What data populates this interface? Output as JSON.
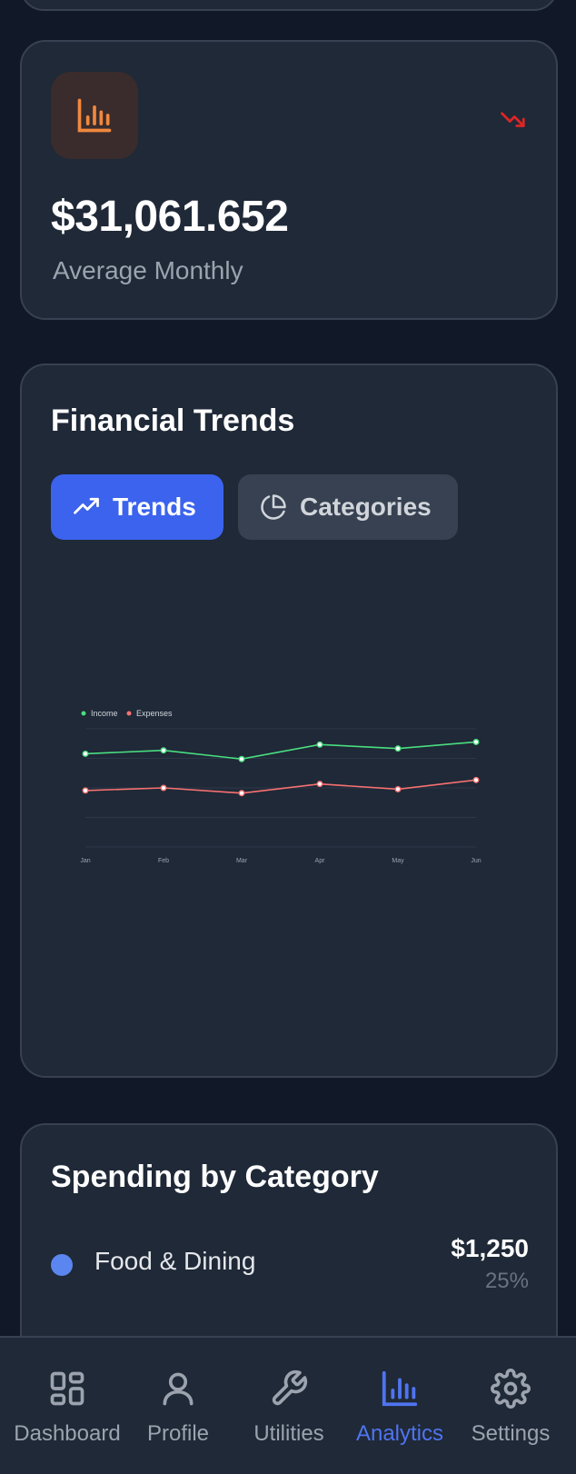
{
  "stat_card": {
    "icon": "bar-chart-icon",
    "trend_icon": "trending-down-icon",
    "value": "$31,061.652",
    "label": "Average Monthly",
    "accent": "#f0883e",
    "trend_color": "#dc2626"
  },
  "trends_card": {
    "title": "Financial Trends",
    "tabs": [
      {
        "label": "Trends",
        "icon": "trending-up-icon",
        "active": true
      },
      {
        "label": "Categories",
        "icon": "pie-chart-icon",
        "active": false
      }
    ]
  },
  "chart_data": {
    "type": "line",
    "x": [
      "Jan",
      "Feb",
      "Mar",
      "Apr",
      "May",
      "Jun"
    ],
    "series": [
      {
        "name": "Income",
        "color": "#4ade80",
        "values": [
          35500,
          36800,
          33500,
          39000,
          37500,
          40000
        ]
      },
      {
        "name": "Expenses",
        "color": "#f87171",
        "values": [
          21500,
          22500,
          20500,
          24000,
          22000,
          25500
        ]
      }
    ],
    "ylim": [
      0,
      45000
    ],
    "grid": true,
    "legend": "top-left",
    "title": "",
    "xlabel": "",
    "ylabel": ""
  },
  "spending_card": {
    "title": "Spending by Category",
    "categories": [
      {
        "name": "Food & Dining",
        "amount": "$1,250",
        "percent": "25%",
        "color": "#5b86f0"
      }
    ]
  },
  "bottom_nav": {
    "items": [
      {
        "label": "Dashboard",
        "icon": "dashboard-icon",
        "active": false
      },
      {
        "label": "Profile",
        "icon": "user-icon",
        "active": false
      },
      {
        "label": "Utilities",
        "icon": "wrench-icon",
        "active": false
      },
      {
        "label": "Analytics",
        "icon": "bar-chart-icon",
        "active": true
      },
      {
        "label": "Settings",
        "icon": "gear-icon",
        "active": false
      }
    ],
    "active_color": "#4f74f0"
  }
}
